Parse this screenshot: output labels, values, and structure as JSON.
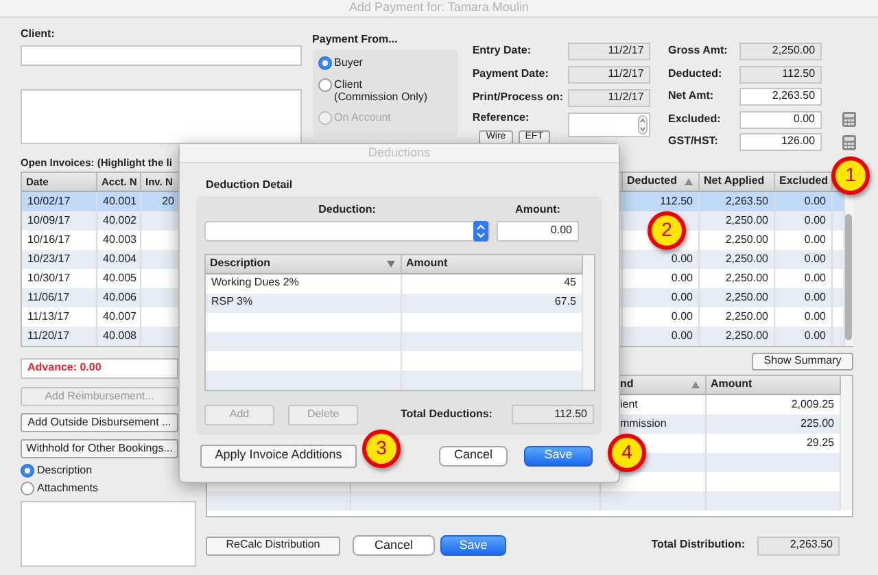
{
  "window": {
    "title": "Add Payment for: Tamara Moulin"
  },
  "client": {
    "label": "Client:"
  },
  "payment_from": {
    "label": "Payment From...",
    "options": [
      {
        "label": "Buyer",
        "selected": true,
        "disabled": false
      },
      {
        "label": "Client",
        "note": "(Commission Only)",
        "selected": false,
        "disabled": false
      },
      {
        "label": "On Account",
        "selected": false,
        "disabled": true
      }
    ]
  },
  "dates": [
    {
      "label": "Entry Date:",
      "value": "11/2/17"
    },
    {
      "label": "Payment Date:",
      "value": "11/2/17"
    },
    {
      "label": "Print/Process on:",
      "value": "11/2/17"
    }
  ],
  "reference": {
    "label": "Reference:",
    "buttons": [
      "Wire",
      "EFT"
    ]
  },
  "amounts": [
    {
      "label": "Gross Amt:",
      "value": "2,250.00",
      "editable": false,
      "calculator": false
    },
    {
      "label": "Deducted:",
      "value": "112.50",
      "editable": false,
      "calculator": false
    },
    {
      "label": "Net Amt:",
      "value": "2,263.50",
      "editable": true,
      "calculator": false
    },
    {
      "label": "Excluded:",
      "value": "0.00",
      "editable": true,
      "calculator": true
    },
    {
      "label": "GST/HST:",
      "value": "126.00",
      "editable": true,
      "calculator": true
    }
  ],
  "invoices": {
    "label": "Open Invoices: (Highlight the li",
    "columns_left": [
      "Date",
      "Acct. N",
      "Inv. N"
    ],
    "columns_right": [
      {
        "label": "Deducted",
        "sorted": true
      },
      {
        "label": "Net Applied",
        "sorted": false
      },
      {
        "label": "Excluded",
        "sorted": false
      }
    ],
    "rows": [
      {
        "date": "10/02/17",
        "acct": "40.001",
        "inv": "20",
        "deducted": "112.50",
        "net_applied": "2,263.50",
        "excluded": "0.00",
        "selected": true
      },
      {
        "date": "10/09/17",
        "acct": "40.002",
        "net_applied": "2,250.00",
        "excluded": "0.00",
        "selected": false
      },
      {
        "date": "10/16/17",
        "acct": "40.003",
        "net_applied": "2,250.00",
        "excluded": "0.00",
        "selected": false
      },
      {
        "date": "10/23/17",
        "acct": "40.004",
        "deducted": "0.00",
        "net_applied": "2,250.00",
        "excluded": "0.00",
        "selected": false
      },
      {
        "date": "10/30/17",
        "acct": "40.005",
        "deducted": "0.00",
        "net_applied": "2,250.00",
        "excluded": "0.00",
        "selected": false
      },
      {
        "date": "11/06/17",
        "acct": "40.006",
        "deducted": "0.00",
        "net_applied": "2,250.00",
        "excluded": "0.00",
        "selected": false
      },
      {
        "date": "11/13/17",
        "acct": "40.007",
        "deducted": "0.00",
        "net_applied": "2,250.00",
        "excluded": "0.00",
        "selected": false
      },
      {
        "date": "11/20/17",
        "acct": "40.008",
        "deducted": "0.00",
        "net_applied": "2,250.00",
        "excluded": "0.00",
        "selected": false
      }
    ]
  },
  "advance": "Advance: 0.00",
  "side_buttons": [
    {
      "label": "Add Reimbursement...",
      "disabled": true
    },
    {
      "label": "Add Outside Disbursement ...",
      "disabled": false
    },
    {
      "label": "Withhold for Other Bookings...",
      "disabled": false
    }
  ],
  "note_options": [
    {
      "label": "Description",
      "selected": true
    },
    {
      "label": "Attachments",
      "selected": false
    }
  ],
  "show_summary": "Show Summary",
  "distribution": {
    "columns": [
      {
        "label": "nd",
        "sorted": true
      },
      {
        "label": "Amount",
        "sorted": false
      }
    ],
    "rows": [
      {
        "name": "ient",
        "amount": "2,009.25"
      },
      {
        "name": "mmission",
        "amount": "225.00"
      },
      {
        "amount": "29.25"
      }
    ]
  },
  "footer": {
    "buttons": [
      {
        "label": "ReCalc Distribution",
        "kind": "square"
      },
      {
        "label": "Cancel",
        "kind": "default"
      },
      {
        "label": "Save",
        "kind": "primary"
      }
    ],
    "total_label": "Total Distribution:",
    "total_value": "2,263.50"
  },
  "dialog": {
    "title": "Deductions",
    "section": "Deduction Detail",
    "deduction_label": "Deduction:",
    "amount_label": "Amount:",
    "amount_value": "0.00",
    "columns": [
      {
        "label": "Description",
        "sorted": true
      },
      {
        "label": "Amount",
        "sorted": false
      }
    ],
    "rows": [
      {
        "description": "Working Dues 2%",
        "amount": "45"
      },
      {
        "description": "RSP 3%",
        "amount": "67.5"
      }
    ],
    "table_buttons": [
      {
        "label": "Add",
        "disabled": true
      },
      {
        "label": "Delete",
        "disabled": true
      }
    ],
    "total_label": "Total Deductions:",
    "total_value": "112.50",
    "buttons": [
      {
        "label": "Apply Invoice Additions",
        "kind": "square"
      },
      {
        "label": "Cancel",
        "kind": "default"
      },
      {
        "label": "Save",
        "kind": "primary"
      }
    ]
  },
  "callouts": [
    "1",
    "2",
    "3",
    "4"
  ]
}
